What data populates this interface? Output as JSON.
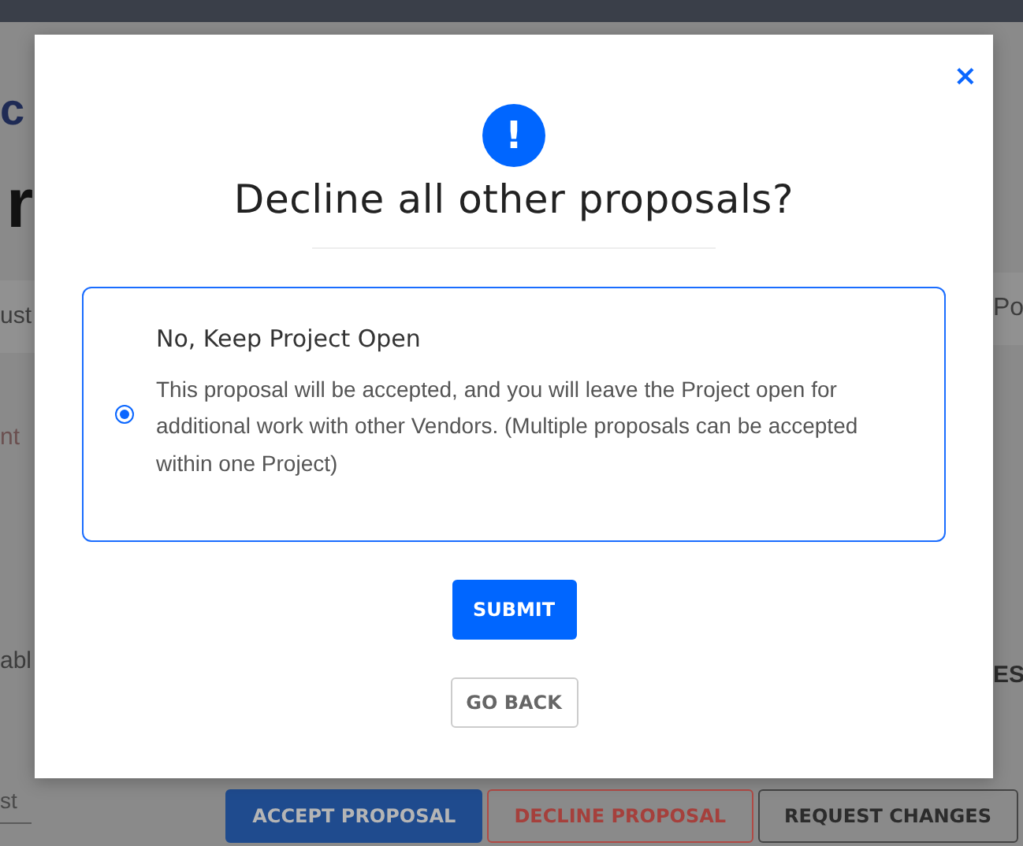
{
  "background": {
    "logo_fragment": "c",
    "heading_fragment": "r",
    "tab_fragment_left": "ust",
    "tab_fragment_right": "Po",
    "field_fragment": "nt",
    "row_fragment": "abl",
    "right_fragment": "ES",
    "input_fragment": "st",
    "actions": [
      {
        "label": "ACCEPT PROPOSAL",
        "kind": "primary"
      },
      {
        "label": "DECLINE PROPOSAL",
        "kind": "danger"
      },
      {
        "label": "REQUEST CHANGES",
        "kind": "outline"
      }
    ]
  },
  "dialog": {
    "close": "×",
    "icon": "!",
    "title": "Decline all other proposals?",
    "options": [
      {
        "title": "No, Keep Project Open",
        "description": "This proposal will be accepted, and you will leave the Project open for additional work with other Vendors. (Multiple proposals can be accepted within one Project)",
        "selected": true
      }
    ],
    "submit": "SUBMIT",
    "back": "GO BACK"
  }
}
